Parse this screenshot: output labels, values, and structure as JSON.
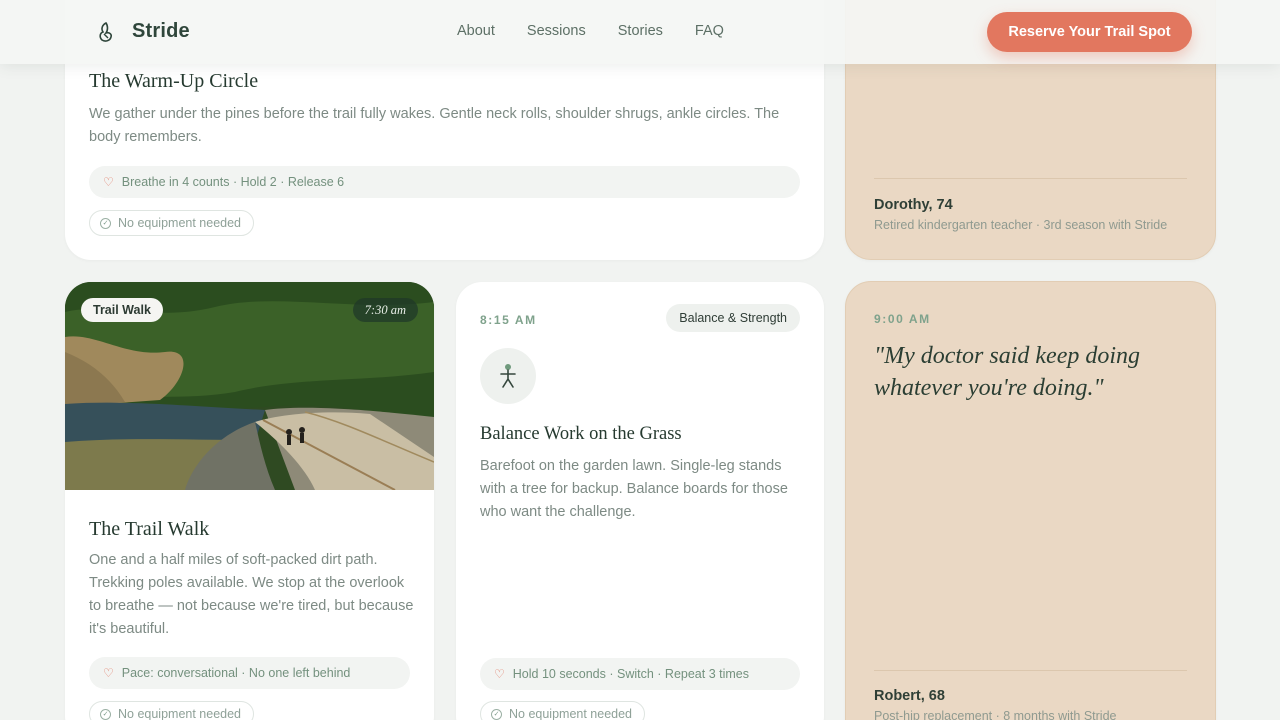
{
  "header": {
    "brand": "Stride",
    "nav": [
      "About",
      "Sessions",
      "Stories",
      "FAQ"
    ],
    "cta": "Reserve Your Trail Spot",
    "accent_color": "#e2775f"
  },
  "warmup": {
    "title": "The Warm-Up Circle",
    "text": "We gather under the pines before the trail fully wakes. Gentle neck rolls, shoulder shrugs, ankle circles. The body remembers.",
    "tip": "Breathe in 4 counts · Hold 2 · Release 6",
    "equipment": "No equipment needed"
  },
  "testimonial_top": {
    "name": "Dorothy, 74",
    "meta": "Retired kindergarten teacher · 3rd season with Stride"
  },
  "trail": {
    "tag": "Trail Walk",
    "time": "7:30 am",
    "title": "The Trail Walk",
    "text": "One and a half miles of soft-packed dirt path. Trekking poles available. We stop at the overlook to breathe — not because we're tired, but because it's beautiful.",
    "tip": "Pace: conversational · No one left behind",
    "equipment": "No equipment needed"
  },
  "balance": {
    "time": "8:15 AM",
    "category": "Balance & Strength",
    "icon": "person-balance-icon",
    "title": "Balance Work on the Grass",
    "text": "Barefoot on the garden lawn. Single-leg stands with a tree for backup. Balance boards for those who want the challenge.",
    "tip": "Hold 10 seconds · Switch · Repeat 3 times",
    "equipment": "No equipment needed"
  },
  "testimonial_bottom": {
    "time": "9:00 AM",
    "quote": "\"My doctor said keep doing whatever you're doing.\"",
    "name": "Robert, 68",
    "meta": "Post-hip replacement · 8 months with Stride"
  }
}
